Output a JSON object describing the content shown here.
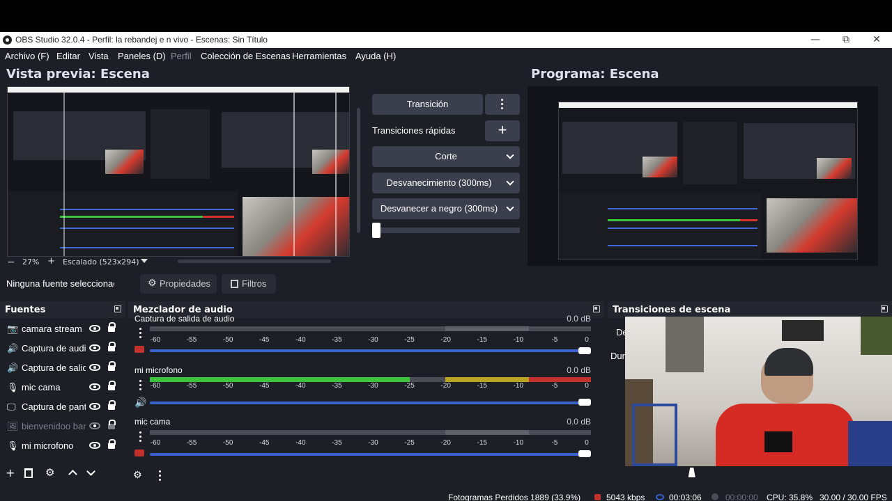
{
  "window": {
    "title": "OBS Studio 32.0.4 - Perfil: la rebandej e n  vivo - Escenas: Sin Título",
    "minimize": "—",
    "maximize": "⧉",
    "close": "✕"
  },
  "menu": [
    "Archivo (F)",
    "Editar",
    "Vista",
    "Paneles (D)",
    "Perfil",
    "Colección de Escenas",
    "Herramientas",
    "Ayuda (H)"
  ],
  "preview": {
    "title": "Vista previa: Escena",
    "zoom": "27%",
    "scale_label": "Escalado (523x294)"
  },
  "program": {
    "title": "Programa: Escena"
  },
  "transitions_center": {
    "transition_button": "Transición",
    "quick_label": "Transiciones rápidas",
    "options": [
      "Corte",
      "Desvanecimiento (300ms)",
      "Desvanecer a negro (300ms)"
    ]
  },
  "source_toolbar": {
    "no_source": "Ninguna fuente seleccionac",
    "properties": "Propiedades",
    "filters": "Filtros"
  },
  "sources": {
    "title": "Fuentes",
    "items": [
      {
        "icon": "camera-icon",
        "label": "camara stream"
      },
      {
        "icon": "speaker-icon",
        "label": "Captura de audio"
      },
      {
        "icon": "speaker-icon",
        "label": "Captura de salida"
      },
      {
        "icon": "mic-icon",
        "label": "mic cama"
      },
      {
        "icon": "monitor-icon",
        "label": "Captura de pantalla"
      },
      {
        "icon": "image-icon",
        "label": "bienvenidoo bar"
      },
      {
        "icon": "mic-icon",
        "label": "mi microfono"
      }
    ]
  },
  "mixer": {
    "title": "Mezclador de audio",
    "scale_ticks": [
      "-60",
      "-55",
      "-50",
      "-45",
      "-40",
      "-35",
      "-30",
      "-25",
      "-20",
      "-15",
      "-10",
      "-5",
      "0"
    ],
    "tracks": [
      {
        "name": "Captura de salida de audio",
        "db": "0.0 dB",
        "level": 0,
        "muted": true
      },
      {
        "name": "mi microfono",
        "db": "0.0 dB",
        "level": 0.59,
        "muted": false
      },
      {
        "name": "mic cama",
        "db": "0.0 dB",
        "level": 0,
        "muted": true
      }
    ]
  },
  "scene_transitions": {
    "title": "Transiciones de escena",
    "label_1": "De",
    "label_2": "Dur"
  },
  "status": {
    "dropped": "Fotogramas Perdidos 1889 (33.9%)",
    "bitrate": "5043 kbps",
    "time_live": "00:03:06",
    "time_rec": "00:00:00",
    "cpu": "CPU: 35.8%",
    "fps": "30.00 / 30.00 FPS"
  },
  "colors": {
    "accent_blue": "#3a63d0",
    "meter_green": "#3cc43c",
    "meter_yellow": "#b9a31f",
    "meter_red": "#c4302b",
    "bg": "#1d1f26"
  }
}
